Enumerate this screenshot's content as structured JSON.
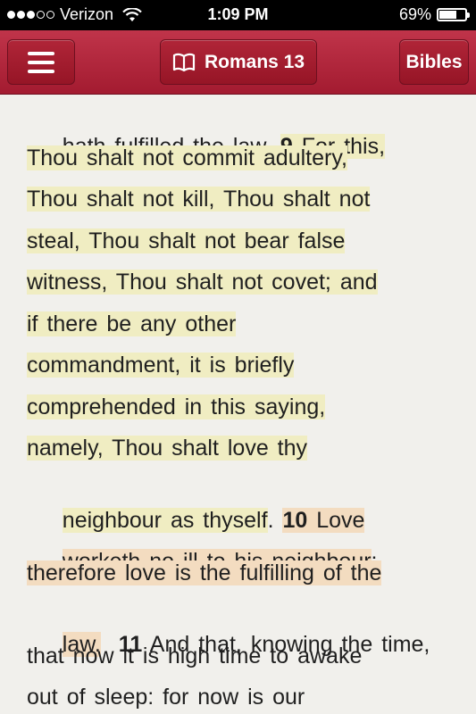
{
  "status_bar": {
    "carrier": "Verizon",
    "time": "1:09 PM",
    "battery_percent_text": "69%",
    "battery_level": 0.69,
    "signal_bars_filled": 3,
    "signal_bars_total": 5
  },
  "nav": {
    "menu_icon": "hamburger-menu-icon",
    "book_icon": "open-book-icon",
    "title": "Romans 13",
    "bibles_label": "Bibles"
  },
  "colors": {
    "nav_bar": "#b0283c",
    "highlight_verse_9": "#f0edc2",
    "highlight_verse_10": "#f3dcc0",
    "page_background": "#f1f0ec"
  },
  "passage": {
    "lines": [
      {
        "pre": "hath fulfilled the law. ",
        "verse": "9",
        "hl": " For this,"
      },
      {
        "hl": "Thou shalt not commit adultery,"
      },
      {
        "hl": "Thou shalt not kill, Thou shalt not"
      },
      {
        "hl": "steal, Thou shalt not bear false"
      },
      {
        "hl": "witness, Thou shalt not covet; and"
      },
      {
        "hl": "if there be any other"
      },
      {
        "hl": "commandment, it is briefly"
      },
      {
        "hl": "comprehended in this saying,"
      },
      {
        "hl": "namely, Thou shalt love thy"
      },
      {
        "hl": "neighbour as thyself",
        "post": ".",
        "verse2": "10",
        "hl2": " Love"
      },
      {
        "hl2only": "worketh no ill to his neighbour",
        "post2": ":"
      },
      {
        "hl2only": "therefore love is the fulfilling of the"
      },
      {
        "hl2only": "law.",
        "post2": " ",
        "verse3": "11",
        "rest": " And that, knowing the time,"
      },
      {
        "rest": "that now it is high time to awake"
      },
      {
        "rest": "out of sleep: for now is our"
      }
    ]
  }
}
